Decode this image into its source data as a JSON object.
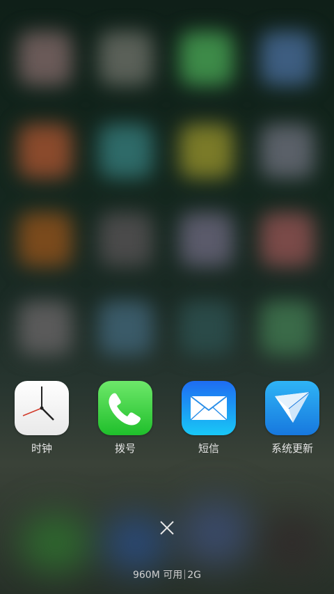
{
  "tray": {
    "apps": [
      {
        "label": "时钟",
        "icon": "clock-icon"
      },
      {
        "label": "拨号",
        "icon": "phone-icon"
      },
      {
        "label": "短信",
        "icon": "mail-icon"
      },
      {
        "label": "系统更新",
        "icon": "paper-plane-icon"
      }
    ]
  },
  "footer": {
    "memory": "960M 可用",
    "network": "2G"
  },
  "colors": {
    "phone_green": "#1fbf2b",
    "sms_blue": "#1e6cf2",
    "update_blue": "#1778de",
    "label_text": "#e6e6e6"
  }
}
